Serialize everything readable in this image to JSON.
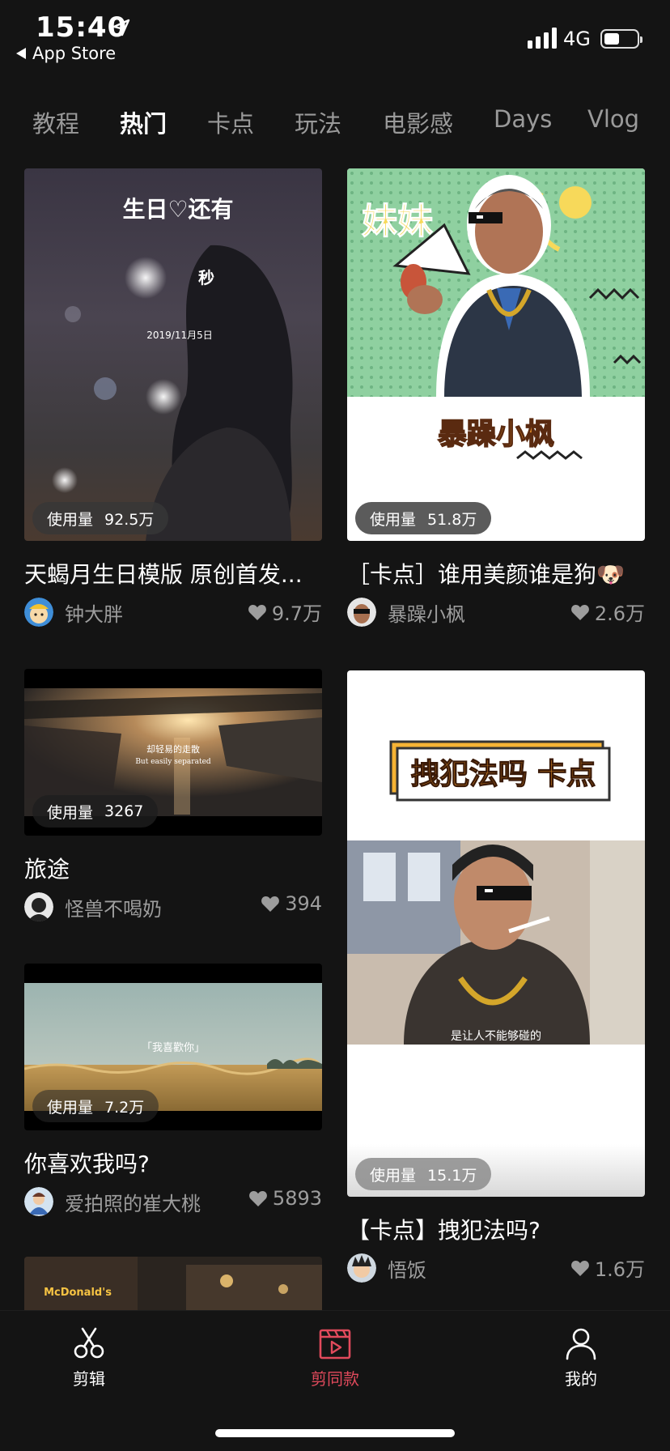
{
  "status_bar": {
    "time": "15:40",
    "back_label": "App Store",
    "network": "4G"
  },
  "tabs": [
    {
      "label": "教程"
    },
    {
      "label": "热门"
    },
    {
      "label": "卡点"
    },
    {
      "label": "玩法"
    },
    {
      "label": "电影感"
    },
    {
      "label": "Days"
    },
    {
      "label": "Vlog"
    }
  ],
  "active_tab": "热门",
  "usage_label": "使用量",
  "cards": [
    {
      "title": "天蝎月生日模版 原创首发...",
      "author": "钟大胖",
      "likes": "9.7万",
      "usage": "92.5万",
      "overlay_text": [
        "生日♡还有",
        "秒",
        "2019/11月5日"
      ]
    },
    {
      "title": "［卡点］谁用美颜谁是狗🐶",
      "author": "暴躁小枫",
      "likes": "2.6万",
      "usage": "51.8万",
      "overlay_text": [
        "妹妹",
        "暴躁小枫"
      ]
    },
    {
      "title": "旅途",
      "author": "怪兽不喝奶",
      "likes": "394",
      "usage": "3267",
      "overlay_text": [
        "却轻易的走散",
        "But easily separated"
      ]
    },
    {
      "title": "【卡点】拽犯法吗?",
      "author": "悟饭",
      "likes": "1.6万",
      "usage": "15.1万",
      "overlay_text": [
        "拽犯法吗 卡点",
        "是让人不能够碰的"
      ]
    },
    {
      "title": "你喜欢我吗?",
      "author": "爱拍照的崔大桃",
      "likes": "5893",
      "usage": "7.2万",
      "overlay_text": [
        "「我喜歡你」"
      ]
    },
    {
      "overlay_text": [
        "McDonald's"
      ]
    }
  ],
  "tab_bar": [
    {
      "label": "剪辑",
      "icon": "scissors-icon"
    },
    {
      "label": "剪同款",
      "icon": "template-video-icon"
    },
    {
      "label": "我的",
      "icon": "profile-icon"
    }
  ],
  "colors": {
    "accent": "#e24a5c",
    "background": "#141414",
    "muted": "#9d9d9d"
  }
}
